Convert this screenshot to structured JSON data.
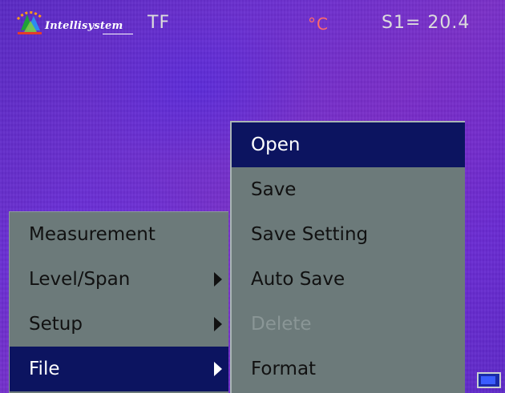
{
  "header": {
    "brand_name": "INTELLISYSTEM",
    "logo_text": "Intellisystem",
    "mode": "TF",
    "unit": "°C",
    "reading": "S1= 20.4"
  },
  "main_menu": {
    "items": [
      {
        "label": "Measurement",
        "selected": false,
        "has_submenu": false
      },
      {
        "label": "Level/Span",
        "selected": false,
        "has_submenu": true
      },
      {
        "label": "Setup",
        "selected": false,
        "has_submenu": true
      },
      {
        "label": "File",
        "selected": true,
        "has_submenu": true
      }
    ]
  },
  "file_menu": {
    "items": [
      {
        "label": "Open",
        "selected": true,
        "disabled": false
      },
      {
        "label": "Save",
        "selected": false,
        "disabled": false
      },
      {
        "label": "Save Setting",
        "selected": false,
        "disabled": false
      },
      {
        "label": "Auto Save",
        "selected": false,
        "disabled": false
      },
      {
        "label": "Delete",
        "selected": false,
        "disabled": true
      },
      {
        "label": "Format",
        "selected": false,
        "disabled": false
      }
    ]
  },
  "colors": {
    "menu_bg": "#6c7a7a",
    "selection_bg": "#0c1460",
    "unit_color": "#ff6a6a",
    "thermal_bg": "#6a2ccc"
  },
  "icons": {
    "logo": "intellisystem-logo",
    "submenu": "triangle-right",
    "battery": "battery-icon"
  }
}
